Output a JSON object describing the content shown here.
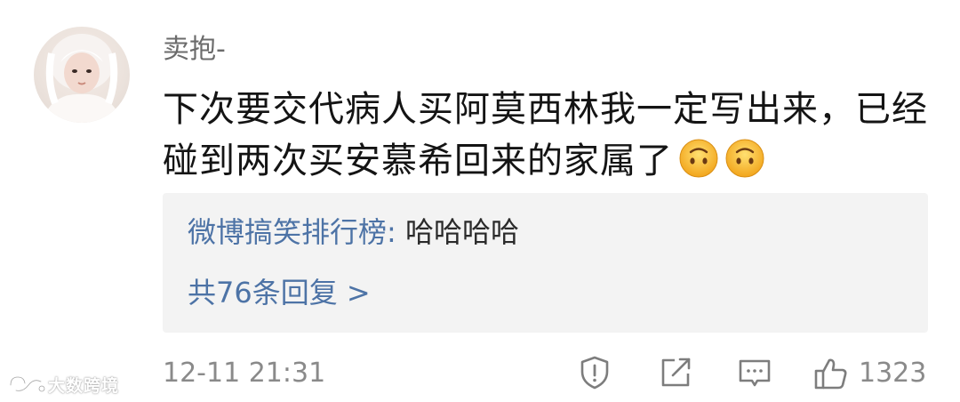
{
  "comment": {
    "username": "卖抱-",
    "content_lines": [
      "下次要交代病人买阿莫西林我一定写出来，已经",
      "碰到两次买安慕希回来的家属了"
    ],
    "emojis": [
      "upside-down-face-icon",
      "upside-down-face-icon"
    ],
    "reply_preview": {
      "author": "微博搞笑排行榜",
      "separator": ":",
      "text": " 哈哈哈哈"
    },
    "reply_count_label": "共76条回复 >",
    "timestamp": "12-11 21:31",
    "like_count": "1323"
  },
  "watermark": {
    "text": "大数跨境"
  },
  "colors": {
    "link_blue": "#4d73a6",
    "meta_gray": "#8a8a8a",
    "reply_bg": "#f3f3f3",
    "emoji_yellow": "#f7c23a"
  }
}
